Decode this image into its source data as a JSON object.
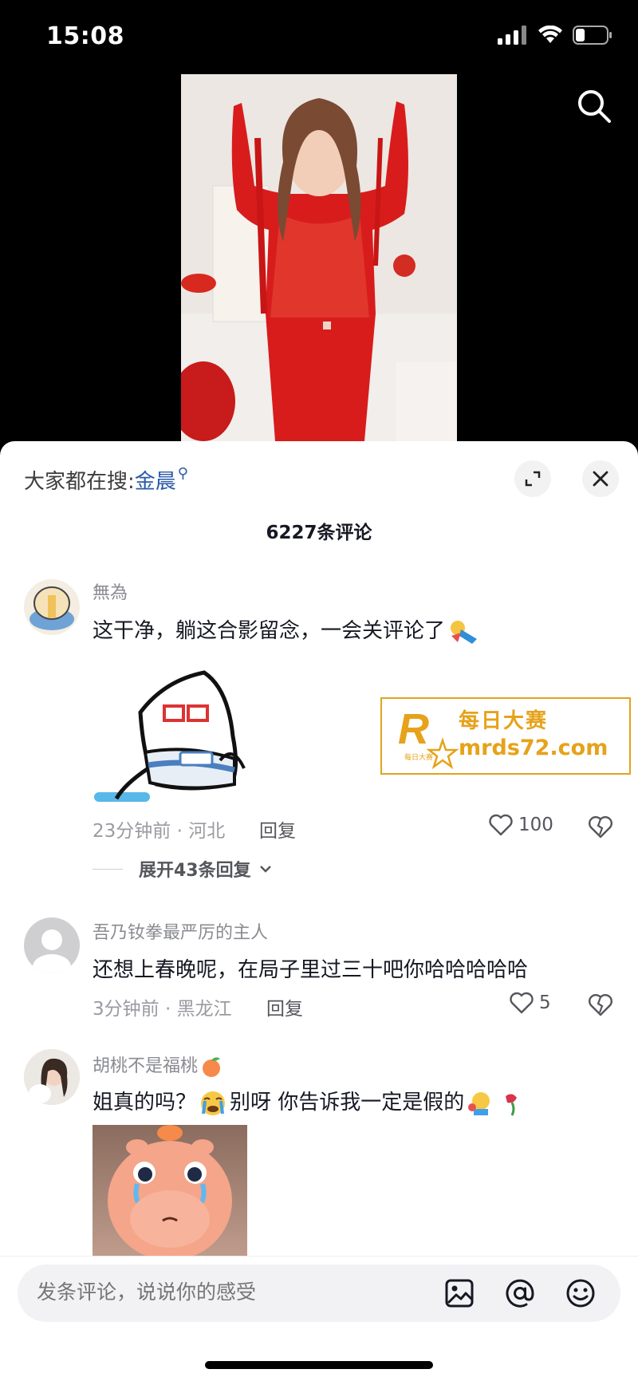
{
  "status_bar": {
    "time": "15:08",
    "battery_level": 0.3
  },
  "video": {
    "search_icon": "search-icon"
  },
  "panel": {
    "trending_prefix": "大家都在搜:",
    "trending_keyword": "金晨",
    "comment_count": "6227条评论",
    "expand_icon": "expand-icon",
    "close_icon": "close-icon"
  },
  "comments": [
    {
      "user": "無為",
      "text": "这干净，躺这合影留念，一会关评论了",
      "time_location": "23分钟前 · 河北",
      "reply_label": "回复",
      "likes": "100",
      "expand_replies": "展开43条回复"
    },
    {
      "user": "吾乃钕拳最严厉的主人",
      "text": "还想上春晚呢，在局子里过三十吧你哈哈哈哈哈",
      "time_location": "3分钟前 · 黑龙江",
      "reply_label": "回复",
      "likes": "5"
    },
    {
      "user": "胡桃不是福桃",
      "text": "姐真的吗？",
      "text2": "别呀 你告诉我一定是假的"
    }
  ],
  "watermark": {
    "logo_letter": "R",
    "logo_small": "每日大赛",
    "brand_cn": "每日大赛",
    "url": "mrds72.com"
  },
  "input": {
    "placeholder": "发条评论，说说你的感受",
    "image_icon": "image-icon",
    "at_icon": "at-icon",
    "emoji_icon": "emoji-icon"
  }
}
